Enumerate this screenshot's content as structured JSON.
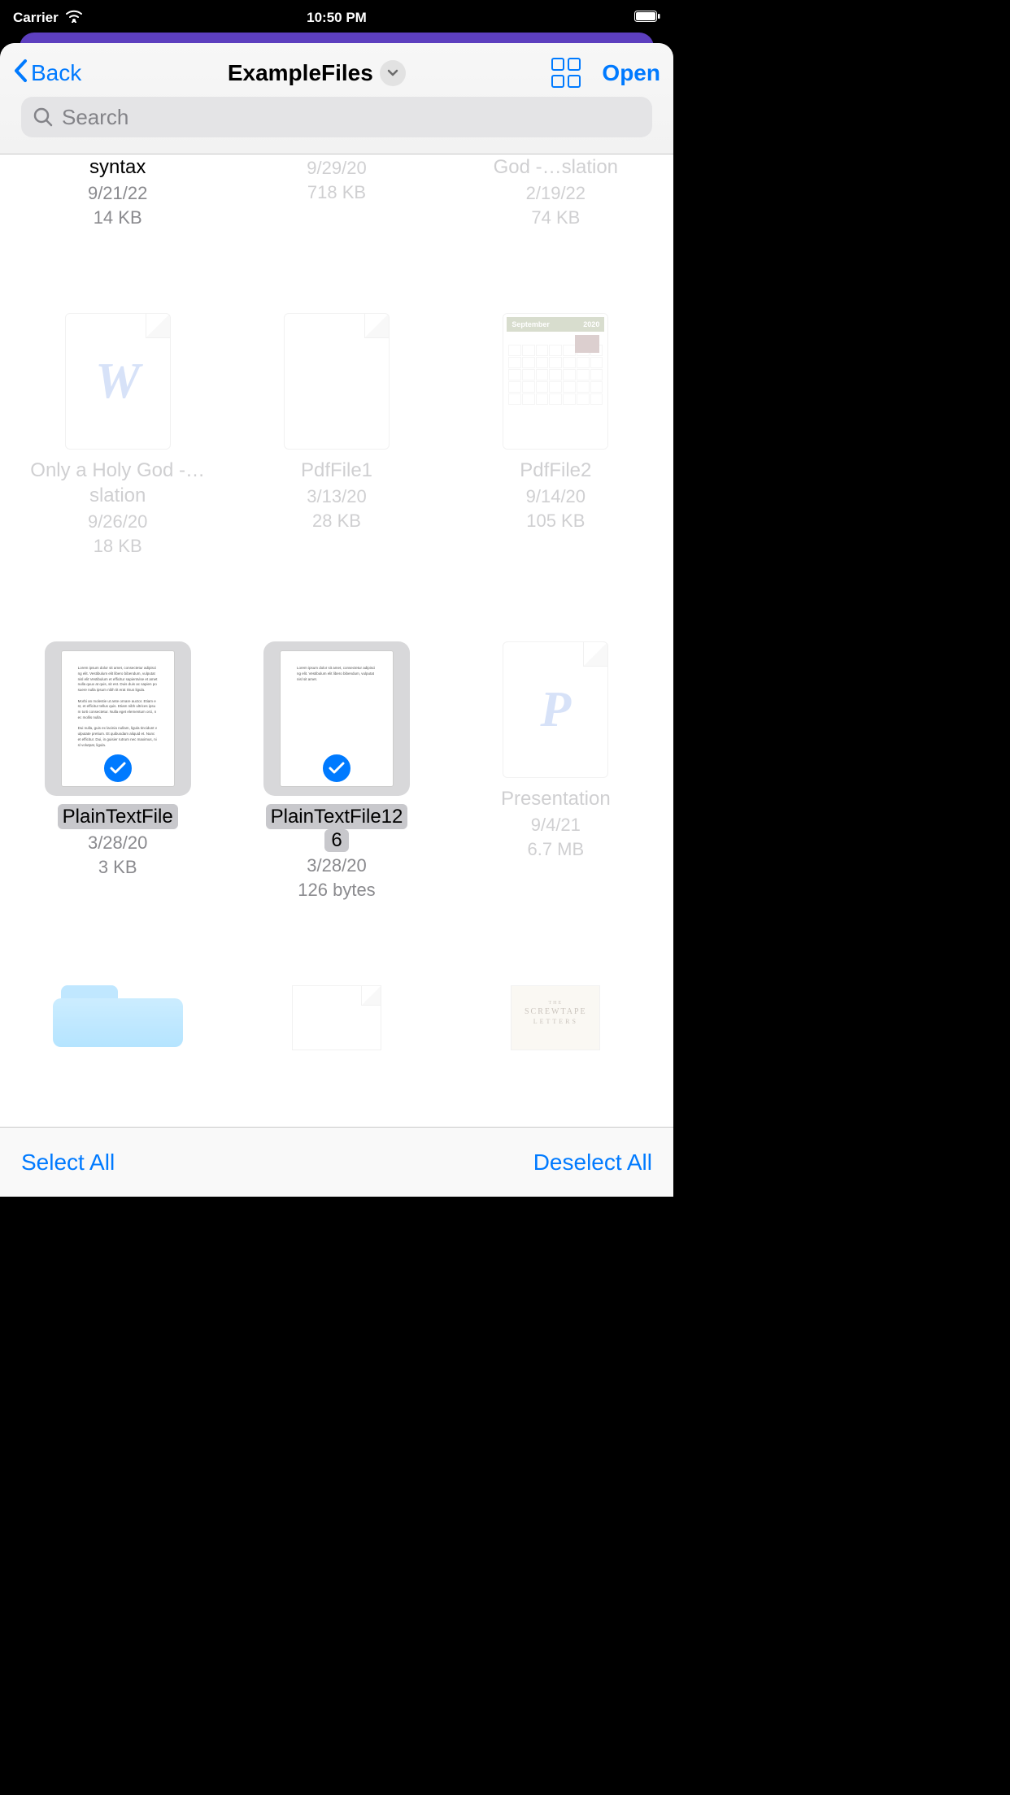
{
  "status": {
    "carrier": "Carrier",
    "time": "10:50 PM"
  },
  "nav": {
    "back_label": "Back",
    "title": "ExampleFiles",
    "open_label": "Open"
  },
  "search": {
    "placeholder": "Search"
  },
  "files": {
    "row0": [
      {
        "name": "syntax",
        "date": "9/21/22",
        "size": "14 KB",
        "selected": false,
        "active": true
      },
      {
        "name": "",
        "date": "9/29/20",
        "size": "718 KB",
        "selected": false,
        "active": false
      },
      {
        "name": "God -…slation",
        "date": "2/19/22",
        "size": "74 KB",
        "selected": false,
        "active": false
      }
    ],
    "row1": [
      {
        "name": "Only a Holy God -…slation",
        "date": "9/26/20",
        "size": "18 KB",
        "glyph": "W"
      },
      {
        "name": "PdfFile1",
        "date": "3/13/20",
        "size": "28 KB",
        "glyph": ""
      },
      {
        "name": "PdfFile2",
        "date": "9/14/20",
        "size": "105 KB",
        "glyph": "cal"
      }
    ],
    "row2": [
      {
        "name": "PlainTextFile",
        "date": "3/28/20",
        "size": "3 KB",
        "selected": true
      },
      {
        "name": "PlainTextFile126",
        "name1": "PlainTextFile12",
        "name2": "6",
        "date": "3/28/20",
        "size": "126 bytes",
        "selected": true
      },
      {
        "name": "Presentation",
        "date": "9/4/21",
        "size": "6.7 MB",
        "glyph": "P"
      }
    ],
    "row3_book": {
      "line1": "THE",
      "line2": "SCREWTAPE",
      "line3": "LETTERS"
    },
    "calendar": {
      "month": "September",
      "year": "2020"
    }
  },
  "toolbar": {
    "select_all": "Select All",
    "deselect_all": "Deselect All"
  }
}
